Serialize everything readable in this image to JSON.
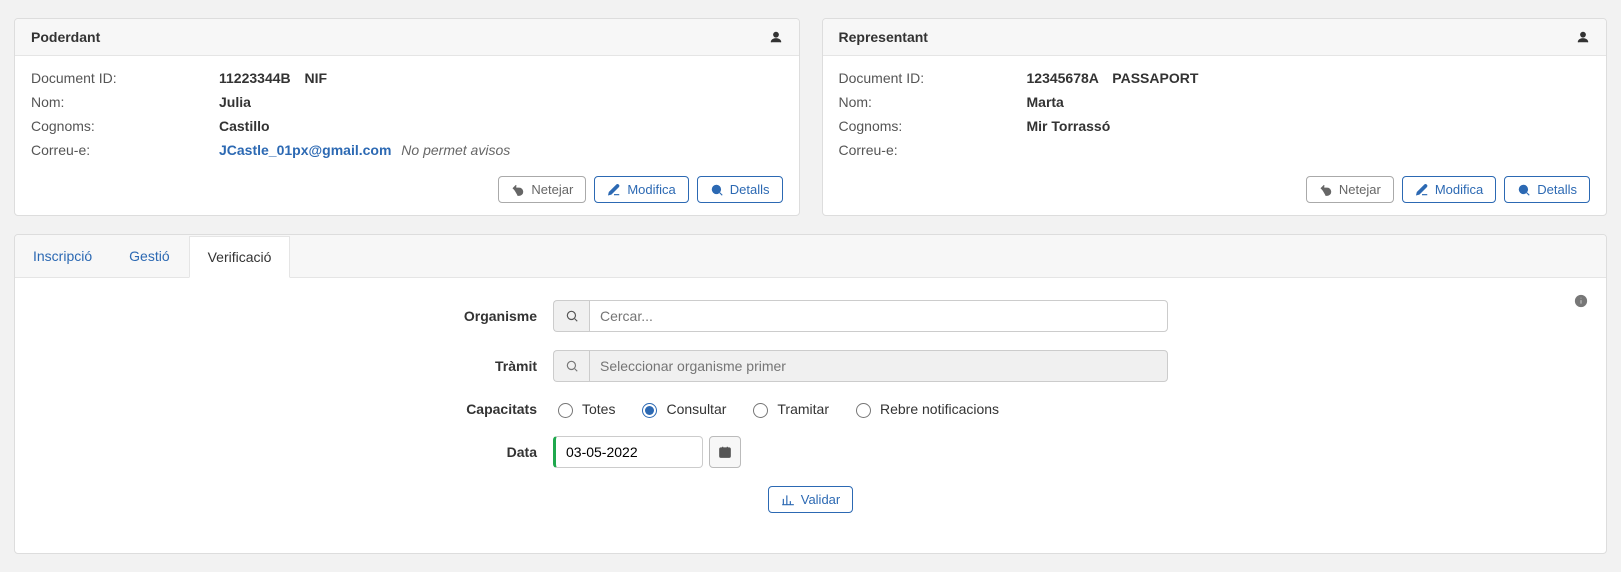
{
  "poderdant": {
    "title": "Poderdant",
    "fields": {
      "doc_label": "Document ID:",
      "doc_value": "11223344B",
      "doc_type": "NIF",
      "nom_label": "Nom:",
      "nom_value": "Julia",
      "cognoms_label": "Cognoms:",
      "cognoms_value": "Castillo",
      "email_label": "Correu-e:",
      "email_value": "JCastle_01px@gmail.com",
      "email_note": "No permet avisos"
    }
  },
  "representant": {
    "title": "Representant",
    "fields": {
      "doc_label": "Document ID:",
      "doc_value": "12345678A",
      "doc_type": "PASSAPORT",
      "nom_label": "Nom:",
      "nom_value": "Marta",
      "cognoms_label": "Cognoms:",
      "cognoms_value": "Mir Torrassó",
      "email_label": "Correu-e:",
      "email_value": ""
    }
  },
  "buttons": {
    "netejar": "Netejar",
    "modifica": "Modifica",
    "detalls": "Detalls",
    "validar": "Validar"
  },
  "tabs": {
    "inscripcio": "Inscripció",
    "gestio": "Gestió",
    "verificacio": "Verificació"
  },
  "form": {
    "organisme_label": "Organisme",
    "organisme_placeholder": "Cercar...",
    "tramit_label": "Tràmit",
    "tramit_placeholder": "Seleccionar organisme primer",
    "capacitats_label": "Capacitats",
    "cap_totes": "Totes",
    "cap_consultar": "Consultar",
    "cap_tramitar": "Tramitar",
    "cap_rebre": "Rebre notificacions",
    "data_label": "Data",
    "data_value": "03-05-2022"
  }
}
